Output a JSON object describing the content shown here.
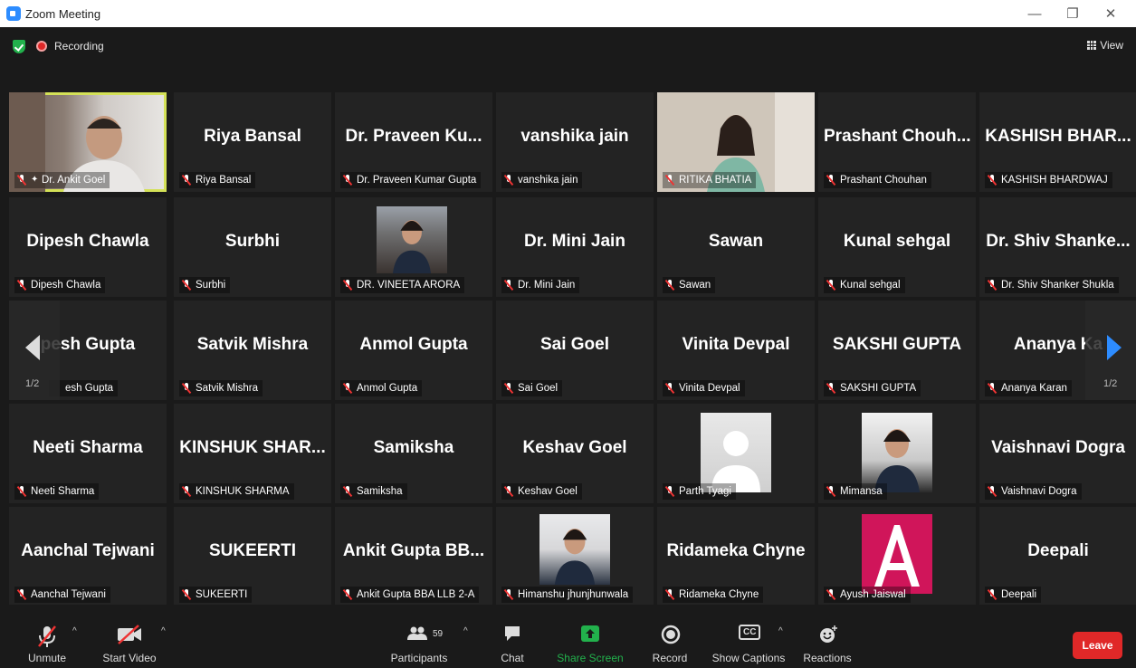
{
  "window": {
    "title": "Zoom Meeting",
    "min": "—",
    "max": "❐",
    "close": "✕"
  },
  "topbar": {
    "recording": "Recording",
    "view": "View"
  },
  "pager": {
    "left": "1/2",
    "right": "1/2"
  },
  "tiles": [
    {
      "big": "",
      "label": "Dr. Ankit Goel"
    },
    {
      "big": "Riya Bansal",
      "label": "Riya Bansal"
    },
    {
      "big": "Dr. Praveen Ku...",
      "label": "Dr. Praveen Kumar Gupta"
    },
    {
      "big": "vanshika jain",
      "label": "vanshika jain"
    },
    {
      "big": "",
      "label": "RITIKA BHATIA"
    },
    {
      "big": "Prashant Chouh...",
      "label": "Prashant Chouhan"
    },
    {
      "big": "KASHISH BHAR...",
      "label": "KASHISH BHARDWAJ"
    },
    {
      "big": "Dipesh Chawla",
      "label": "Dipesh Chawla"
    },
    {
      "big": "Surbhi",
      "label": "Surbhi"
    },
    {
      "big": "",
      "label": "DR. VINEETA ARORA"
    },
    {
      "big": "Dr. Mini Jain",
      "label": "Dr. Mini Jain"
    },
    {
      "big": "Sawan",
      "label": "Sawan"
    },
    {
      "big": "Kunal sehgal",
      "label": "Kunal sehgal"
    },
    {
      "big": "Dr. Shiv Shanke...",
      "label": "Dr. Shiv Shanker Shukla"
    },
    {
      "big": "pesh Gupta",
      "label": "esh Gupta"
    },
    {
      "big": "Satvik Mishra",
      "label": "Satvik Mishra"
    },
    {
      "big": "Anmol Gupta",
      "label": "Anmol Gupta"
    },
    {
      "big": "Sai Goel",
      "label": "Sai Goel"
    },
    {
      "big": "Vinita Devpal",
      "label": "Vinita Devpal"
    },
    {
      "big": "SAKSHI GUPTA",
      "label": "SAKSHI GUPTA"
    },
    {
      "big": "Ananya Ka",
      "label": "Ananya Karan"
    },
    {
      "big": "Neeti Sharma",
      "label": "Neeti Sharma"
    },
    {
      "big": "KINSHUK SHAR...",
      "label": "KINSHUK SHARMA"
    },
    {
      "big": "Samiksha",
      "label": "Samiksha"
    },
    {
      "big": "Keshav Goel",
      "label": "Keshav Goel"
    },
    {
      "big": "",
      "label": "Parth Tyagi"
    },
    {
      "big": "",
      "label": "Mimansa"
    },
    {
      "big": "Vaishnavi Dogra",
      "label": "Vaishnavi Dogra"
    },
    {
      "big": "Aanchal Tejwani",
      "label": "Aanchal Tejwani"
    },
    {
      "big": "SUKEERTI",
      "label": "SUKEERTI"
    },
    {
      "big": "Ankit Gupta BB...",
      "label": "Ankit Gupta BBA LLB 2-A"
    },
    {
      "big": "",
      "label": "Himanshu jhunjhunwala"
    },
    {
      "big": "Ridameka Chyne",
      "label": "Ridameka Chyne"
    },
    {
      "big": "",
      "label": "Ayush Jaiswal"
    },
    {
      "big": "Deepali",
      "label": "Deepali"
    }
  ],
  "toolbar": {
    "unmute": "Unmute",
    "start_video": "Start Video",
    "participants": "Participants",
    "participant_count": "59",
    "chat": "Chat",
    "share": "Share Screen",
    "record": "Record",
    "captions": "Show Captions",
    "cc": "CC",
    "reactions": "Reactions",
    "leave": "Leave"
  },
  "colors": {
    "accent": "#2d8cff",
    "share": "#22b14c",
    "leave": "#e02828",
    "active_border": "#d4e157"
  }
}
